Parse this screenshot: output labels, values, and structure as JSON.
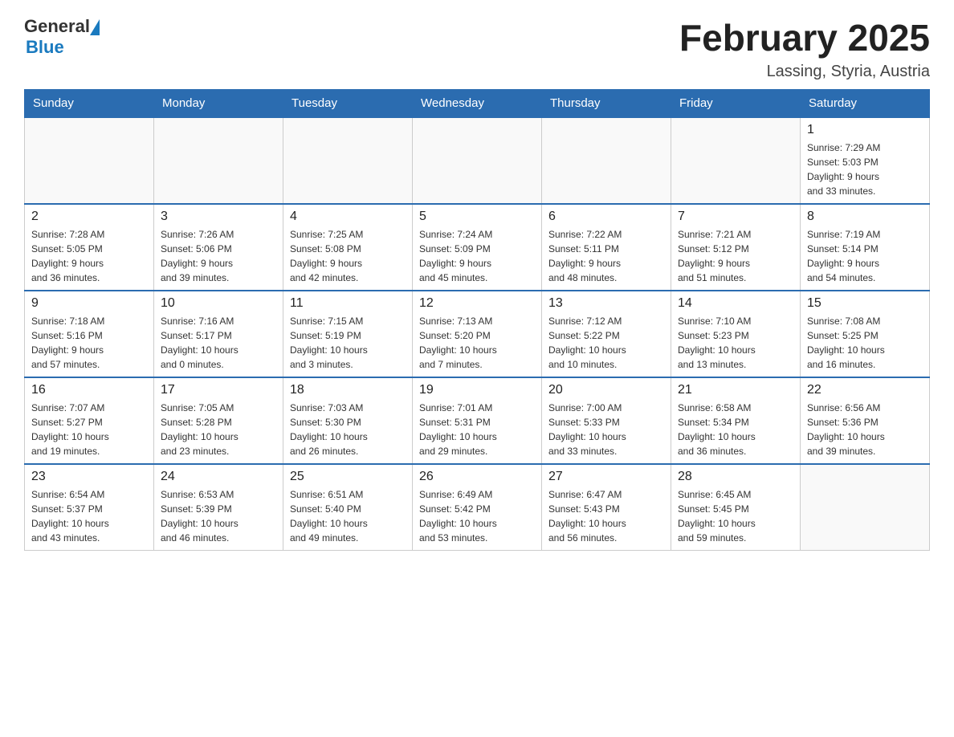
{
  "header": {
    "logo_general": "General",
    "logo_blue": "Blue",
    "title": "February 2025",
    "subtitle": "Lassing, Styria, Austria"
  },
  "weekdays": [
    "Sunday",
    "Monday",
    "Tuesday",
    "Wednesday",
    "Thursday",
    "Friday",
    "Saturday"
  ],
  "weeks": [
    [
      {
        "day": "",
        "info": ""
      },
      {
        "day": "",
        "info": ""
      },
      {
        "day": "",
        "info": ""
      },
      {
        "day": "",
        "info": ""
      },
      {
        "day": "",
        "info": ""
      },
      {
        "day": "",
        "info": ""
      },
      {
        "day": "1",
        "info": "Sunrise: 7:29 AM\nSunset: 5:03 PM\nDaylight: 9 hours\nand 33 minutes."
      }
    ],
    [
      {
        "day": "2",
        "info": "Sunrise: 7:28 AM\nSunset: 5:05 PM\nDaylight: 9 hours\nand 36 minutes."
      },
      {
        "day": "3",
        "info": "Sunrise: 7:26 AM\nSunset: 5:06 PM\nDaylight: 9 hours\nand 39 minutes."
      },
      {
        "day": "4",
        "info": "Sunrise: 7:25 AM\nSunset: 5:08 PM\nDaylight: 9 hours\nand 42 minutes."
      },
      {
        "day": "5",
        "info": "Sunrise: 7:24 AM\nSunset: 5:09 PM\nDaylight: 9 hours\nand 45 minutes."
      },
      {
        "day": "6",
        "info": "Sunrise: 7:22 AM\nSunset: 5:11 PM\nDaylight: 9 hours\nand 48 minutes."
      },
      {
        "day": "7",
        "info": "Sunrise: 7:21 AM\nSunset: 5:12 PM\nDaylight: 9 hours\nand 51 minutes."
      },
      {
        "day": "8",
        "info": "Sunrise: 7:19 AM\nSunset: 5:14 PM\nDaylight: 9 hours\nand 54 minutes."
      }
    ],
    [
      {
        "day": "9",
        "info": "Sunrise: 7:18 AM\nSunset: 5:16 PM\nDaylight: 9 hours\nand 57 minutes."
      },
      {
        "day": "10",
        "info": "Sunrise: 7:16 AM\nSunset: 5:17 PM\nDaylight: 10 hours\nand 0 minutes."
      },
      {
        "day": "11",
        "info": "Sunrise: 7:15 AM\nSunset: 5:19 PM\nDaylight: 10 hours\nand 3 minutes."
      },
      {
        "day": "12",
        "info": "Sunrise: 7:13 AM\nSunset: 5:20 PM\nDaylight: 10 hours\nand 7 minutes."
      },
      {
        "day": "13",
        "info": "Sunrise: 7:12 AM\nSunset: 5:22 PM\nDaylight: 10 hours\nand 10 minutes."
      },
      {
        "day": "14",
        "info": "Sunrise: 7:10 AM\nSunset: 5:23 PM\nDaylight: 10 hours\nand 13 minutes."
      },
      {
        "day": "15",
        "info": "Sunrise: 7:08 AM\nSunset: 5:25 PM\nDaylight: 10 hours\nand 16 minutes."
      }
    ],
    [
      {
        "day": "16",
        "info": "Sunrise: 7:07 AM\nSunset: 5:27 PM\nDaylight: 10 hours\nand 19 minutes."
      },
      {
        "day": "17",
        "info": "Sunrise: 7:05 AM\nSunset: 5:28 PM\nDaylight: 10 hours\nand 23 minutes."
      },
      {
        "day": "18",
        "info": "Sunrise: 7:03 AM\nSunset: 5:30 PM\nDaylight: 10 hours\nand 26 minutes."
      },
      {
        "day": "19",
        "info": "Sunrise: 7:01 AM\nSunset: 5:31 PM\nDaylight: 10 hours\nand 29 minutes."
      },
      {
        "day": "20",
        "info": "Sunrise: 7:00 AM\nSunset: 5:33 PM\nDaylight: 10 hours\nand 33 minutes."
      },
      {
        "day": "21",
        "info": "Sunrise: 6:58 AM\nSunset: 5:34 PM\nDaylight: 10 hours\nand 36 minutes."
      },
      {
        "day": "22",
        "info": "Sunrise: 6:56 AM\nSunset: 5:36 PM\nDaylight: 10 hours\nand 39 minutes."
      }
    ],
    [
      {
        "day": "23",
        "info": "Sunrise: 6:54 AM\nSunset: 5:37 PM\nDaylight: 10 hours\nand 43 minutes."
      },
      {
        "day": "24",
        "info": "Sunrise: 6:53 AM\nSunset: 5:39 PM\nDaylight: 10 hours\nand 46 minutes."
      },
      {
        "day": "25",
        "info": "Sunrise: 6:51 AM\nSunset: 5:40 PM\nDaylight: 10 hours\nand 49 minutes."
      },
      {
        "day": "26",
        "info": "Sunrise: 6:49 AM\nSunset: 5:42 PM\nDaylight: 10 hours\nand 53 minutes."
      },
      {
        "day": "27",
        "info": "Sunrise: 6:47 AM\nSunset: 5:43 PM\nDaylight: 10 hours\nand 56 minutes."
      },
      {
        "day": "28",
        "info": "Sunrise: 6:45 AM\nSunset: 5:45 PM\nDaylight: 10 hours\nand 59 minutes."
      },
      {
        "day": "",
        "info": ""
      }
    ]
  ]
}
